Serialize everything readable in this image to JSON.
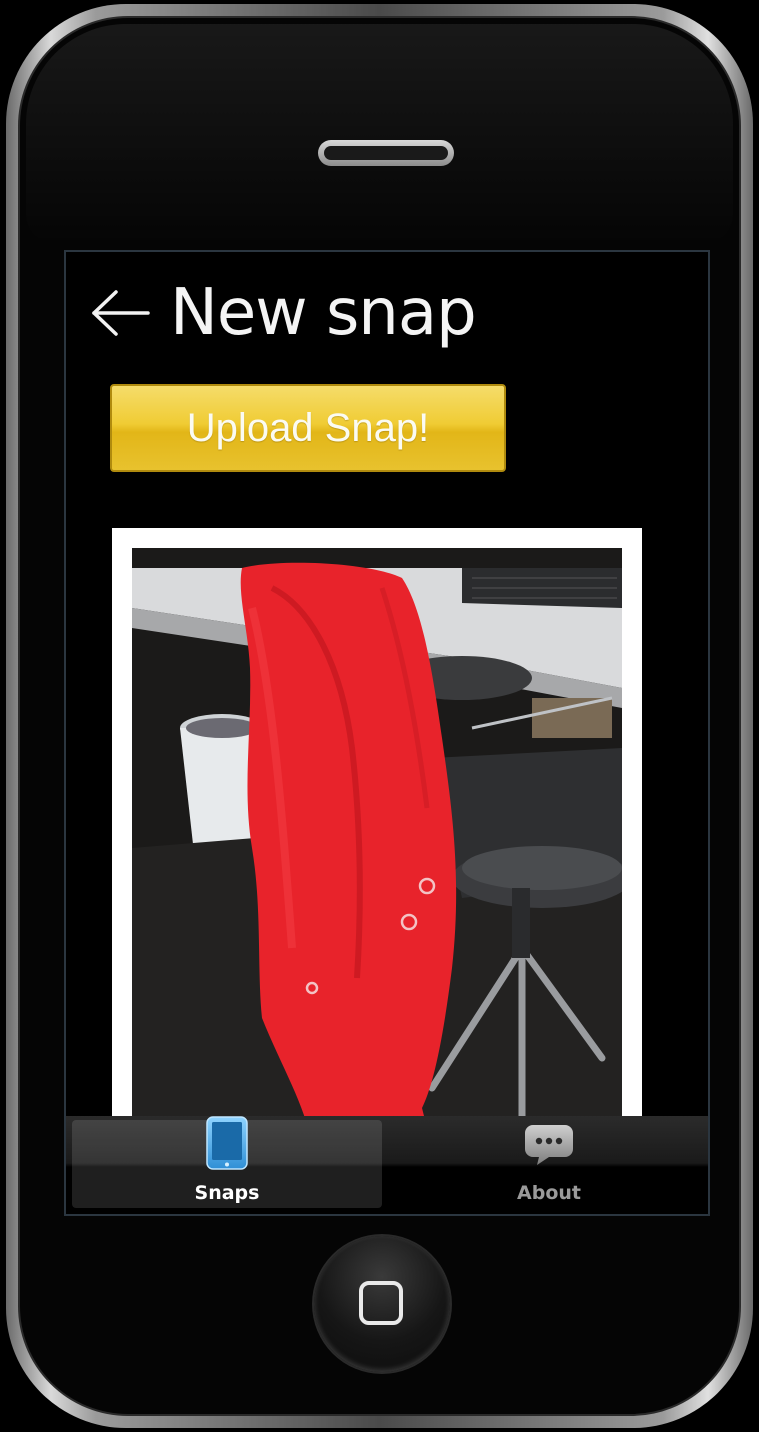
{
  "header": {
    "title": "New snap",
    "back_icon": "back-arrow-icon"
  },
  "upload": {
    "label": "Upload Snap!"
  },
  "photo": {
    "description_icon": "photo-image"
  },
  "tabbar": {
    "tabs": [
      {
        "label": "Snaps",
        "icon": "tablet-icon",
        "active": true
      },
      {
        "label": "About",
        "icon": "speech-bubble-icon",
        "active": false
      }
    ]
  },
  "colors": {
    "accent": "#f0cc34",
    "active_icon": "#5ab8f0"
  }
}
